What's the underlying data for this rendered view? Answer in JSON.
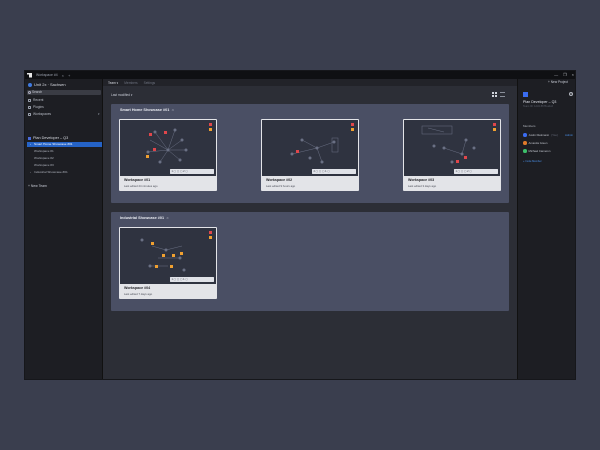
{
  "window": {
    "tab_title": "Workspace #4",
    "close_glyph": "×",
    "plus_glyph": "+",
    "controls": [
      "—",
      "❐",
      "×"
    ]
  },
  "sidebar": {
    "org_name": "Unit 2x · Sachsen",
    "search_label": "Search",
    "nav": [
      {
        "label": "Recent",
        "icon": "clock-icon"
      },
      {
        "label": "Plugins",
        "icon": "plugin-icon"
      },
      {
        "label": "Workspaces",
        "icon": "folder-icon",
        "caret": "▾"
      }
    ],
    "team_name": "Plan Developer – Q3",
    "workspaces": [
      {
        "label": "Smart Home Showcase #01",
        "active": true
      },
      {
        "label": "Workspace #1",
        "active": false
      },
      {
        "label": "Workspace #2",
        "active": false
      },
      {
        "label": "Workspace #3",
        "active": false
      },
      {
        "label": "Industrial Showcase #01",
        "active": false
      }
    ],
    "new_team": "+ New Team"
  },
  "toolbar": {
    "tabs": [
      {
        "label": "Team ▾",
        "active": true
      },
      {
        "label": "Members",
        "active": false
      },
      {
        "label": "Settings",
        "active": false
      }
    ],
    "new_project": "+ New Project"
  },
  "sort_label": "Last modified ▾",
  "groups": [
    {
      "title": "Smart Home Showcase #01",
      "share_glyph": "⋖",
      "cards": [
        {
          "name": "Workspace #01",
          "meta": "Last edited 24 minutes ago",
          "bar": "1 ▢ ▢ ▢ 2 ▢"
        },
        {
          "name": "Workspace #02",
          "meta": "Last edited 9 hours ago",
          "bar": "2 ▢ ▢ ▢ 1 ▢"
        },
        {
          "name": "Workspace #03",
          "meta": "Last edited 3 days ago",
          "bar": "1 ▢ ▢ ▢ 2 ▢"
        }
      ]
    },
    {
      "title": "Industrial Showcase #01",
      "share_glyph": "⋖",
      "cards": [
        {
          "name": "Workspace #04",
          "meta": "Last edited 7 days ago",
          "bar": "1 ▢ ▢ ▢ 1 ▢"
        }
      ]
    }
  ],
  "right_panel": {
    "title": "Plan Developer – Q3",
    "subtitle": "Team ID: 1234-5678-abcd",
    "help_glyph": "?",
    "members_label": "Members",
    "members": [
      {
        "name": "Justin Diekmann",
        "you": "(You)",
        "role": "Admin",
        "color": "#3a6cf0"
      },
      {
        "name": "Amanda Green",
        "you": "",
        "role": "",
        "color": "#e07a2a"
      },
      {
        "name": "Michael Cameron",
        "you": "",
        "role": "",
        "color": "#3cbf6a"
      }
    ],
    "add_member": "+ Invite Member"
  },
  "colors": {
    "accent": "#2563c7",
    "node_red": "#e0464b",
    "node_orange": "#f0a030",
    "node_gray": "#6a7084"
  }
}
